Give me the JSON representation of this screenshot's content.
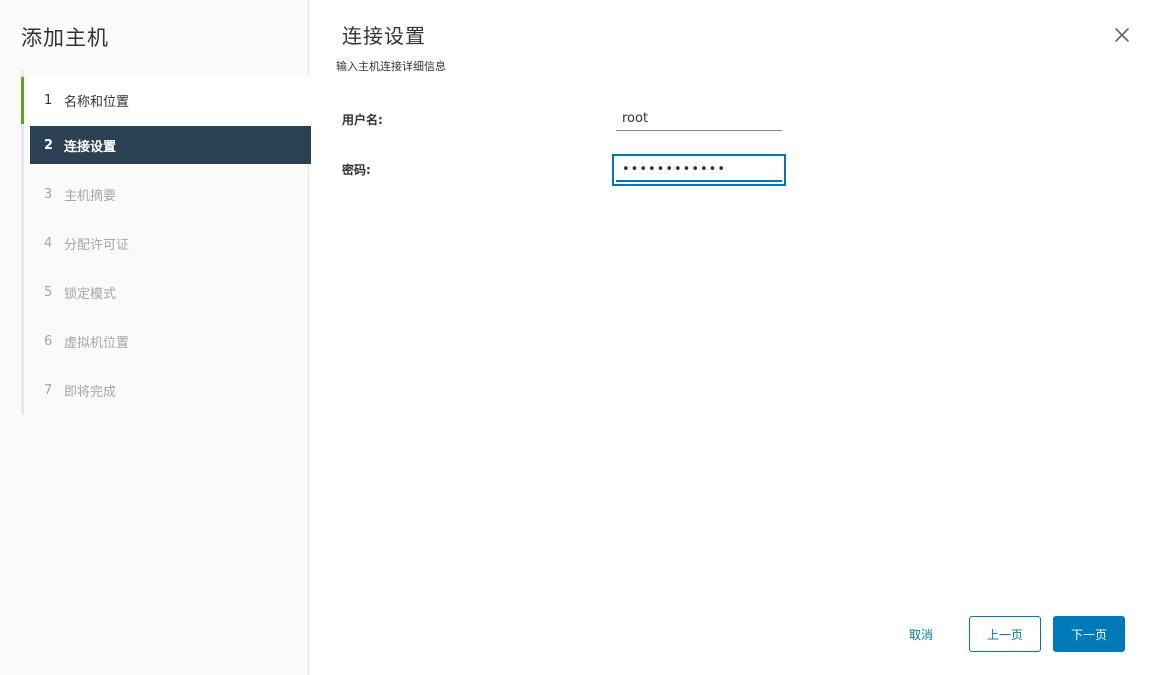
{
  "wizard": {
    "title": "添加主机",
    "steps": [
      {
        "num": "1",
        "label": "名称和位置",
        "state": "done"
      },
      {
        "num": "2",
        "label": "连接设置",
        "state": "active"
      },
      {
        "num": "3",
        "label": "主机摘要",
        "state": "pending"
      },
      {
        "num": "4",
        "label": "分配许可证",
        "state": "pending"
      },
      {
        "num": "5",
        "label": "锁定模式",
        "state": "pending"
      },
      {
        "num": "6",
        "label": "虚拟机位置",
        "state": "pending"
      },
      {
        "num": "7",
        "label": "即将完成",
        "state": "pending"
      }
    ]
  },
  "page": {
    "title": "连接设置",
    "subtitle": "输入主机连接详细信息"
  },
  "form": {
    "username_label": "用户名:",
    "username_value": "root",
    "password_label": "密码:",
    "password_value": "••••••••••••"
  },
  "footer": {
    "cancel_label": "取消",
    "prev_label": "上一页",
    "next_label": "下一页"
  },
  "colors": {
    "accent": "#0079b8",
    "active_step_bg": "#2b4052",
    "done_step_marker": "#62a420"
  },
  "icons": {
    "close": "close-icon"
  }
}
